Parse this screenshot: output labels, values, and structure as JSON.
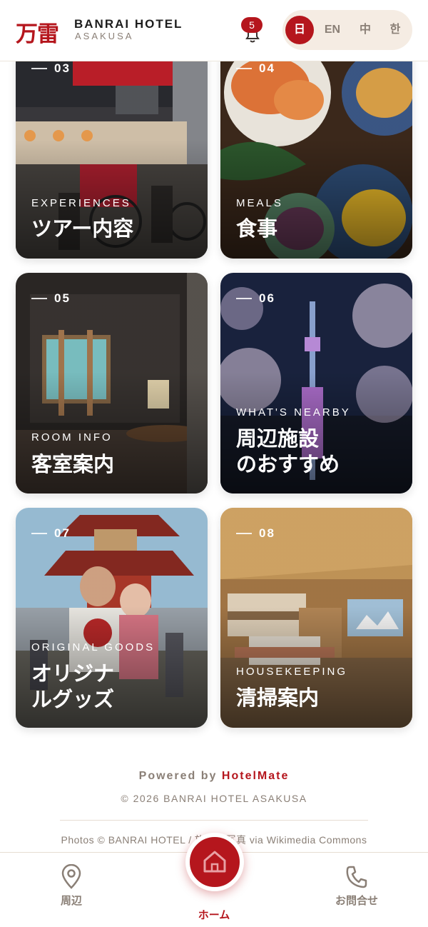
{
  "header": {
    "logo_kanji": "万雷",
    "brand_name": "BANRAI HOTEL",
    "brand_sub": "ASAKUSA",
    "notification_count": "5",
    "languages": [
      {
        "label": "日",
        "active": true
      },
      {
        "label": "EN",
        "active": false
      },
      {
        "label": "中",
        "active": false
      },
      {
        "label": "한",
        "active": false
      }
    ]
  },
  "cards": [
    {
      "number": "03",
      "label": "EXPERIENCES",
      "title": "ツアー内容"
    },
    {
      "number": "04",
      "label": "MEALS",
      "title": "食事"
    },
    {
      "number": "05",
      "label": "ROOM INFO",
      "title": "客室案内"
    },
    {
      "number": "06",
      "label": "WHAT'S NEARBY",
      "title": "周辺施設\nのおすすめ"
    },
    {
      "number": "07",
      "label": "ORIGINAL GOODS",
      "title": "オリジナ\nルグッズ"
    },
    {
      "number": "08",
      "label": "HOUSEKEEPING",
      "title": "清掃案内"
    }
  ],
  "footer": {
    "powered_prefix": "Powered by",
    "powered_brand": "HotelMate",
    "copyright": "© 2026 BANRAI HOTEL ASAKUSA",
    "credits": "Photos © BANRAI HOTEL / 施設の写真 via Wikimedia Commons (CC BY-SA)"
  },
  "bottom_nav": {
    "nearby_label": "周辺",
    "home_label": "ホーム",
    "contact_label": "お問合せ"
  },
  "colors": {
    "accent": "#b5161d",
    "muted": "#8a7f76",
    "pill_bg": "#f5ece3"
  }
}
